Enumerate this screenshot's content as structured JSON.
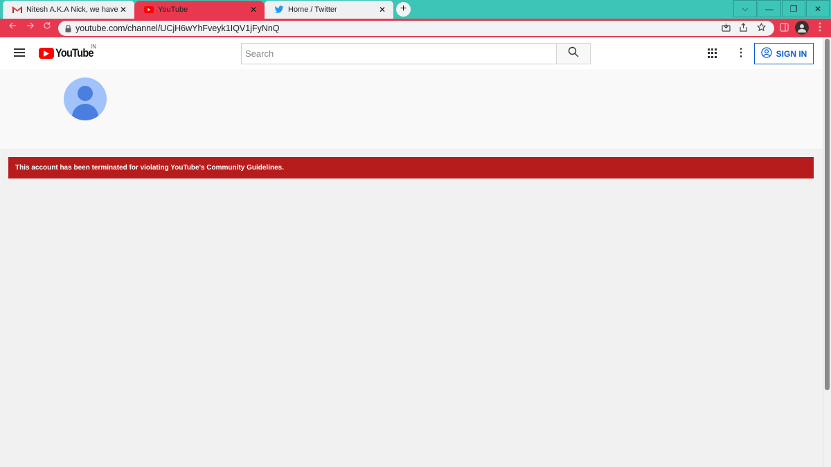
{
  "browser": {
    "tabs": [
      {
        "label": "Nitesh A.K.A Nick, we have remo",
        "icon": "gmail-icon"
      },
      {
        "label": "YouTube",
        "icon": "youtube-icon"
      },
      {
        "label": "Home / Twitter",
        "icon": "twitter-icon"
      }
    ],
    "tab_close_glyph": "✕",
    "new_tab_glyph": "+",
    "address_url": "youtube.com/channel/UCjH6wYhFveyk1IQV1jFyNnQ",
    "window_controls": {
      "dropdown": "⌵",
      "minimize": "—",
      "restore": "❐",
      "close": "✕"
    },
    "colors": {
      "tab_strip": "#3dc6b8",
      "toolbar": "#e8384f",
      "active_tab": "#e8384f"
    }
  },
  "youtube": {
    "brand": "YouTube",
    "country_code": "IN",
    "search_placeholder": "Search",
    "sign_in_label": "SIGN IN",
    "colors": {
      "brand_red": "#ff0000",
      "link_blue": "#065fd4"
    }
  },
  "channel": {
    "termination_message": "This account has been terminated for violating YouTube's Community Guidelines.",
    "banner_color": "#b71c1c"
  }
}
